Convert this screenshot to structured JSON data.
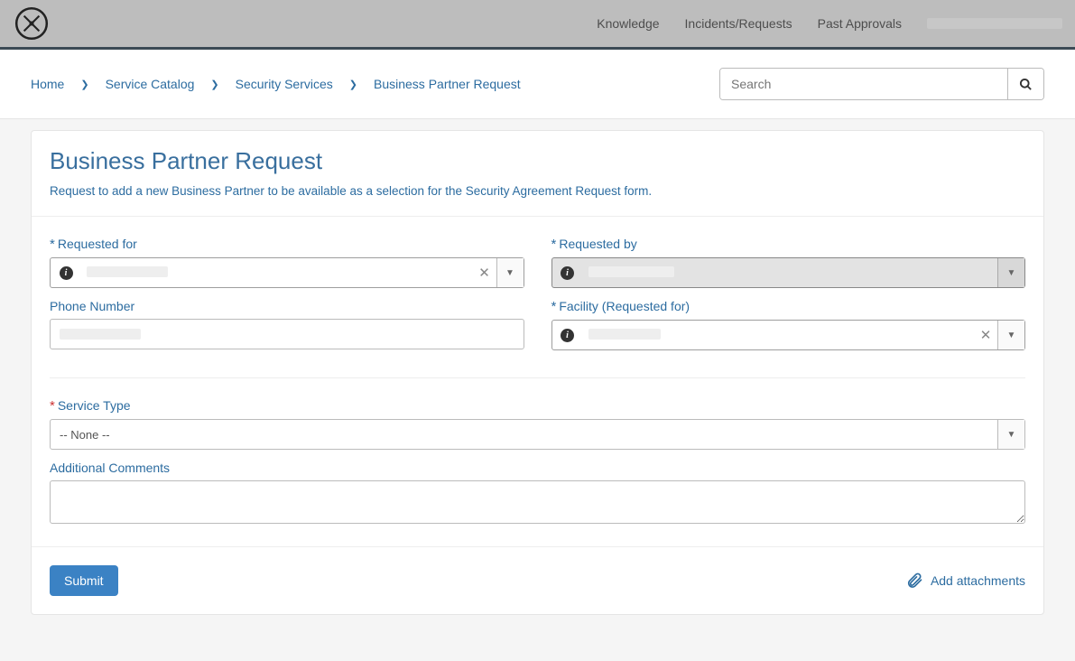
{
  "nav": {
    "knowledge": "Knowledge",
    "incidents": "Incidents/Requests",
    "approvals": "Past Approvals"
  },
  "breadcrumb": {
    "home": "Home",
    "catalog": "Service Catalog",
    "security": "Security Services",
    "current": "Business Partner Request"
  },
  "search": {
    "placeholder": "Search"
  },
  "page": {
    "title": "Business Partner Request",
    "subtitle": "Request to add a new Business Partner to be available as a selection for the Security Agreement Request form."
  },
  "fields": {
    "requested_for_label": "Requested for",
    "requested_by_label": "Requested by",
    "phone_label": "Phone Number",
    "facility_label": "Facility (Requested for)",
    "service_type_label": "Service Type",
    "service_type_value": "-- None --",
    "comments_label": "Additional Comments"
  },
  "footer": {
    "submit": "Submit",
    "attach": "Add attachments"
  }
}
